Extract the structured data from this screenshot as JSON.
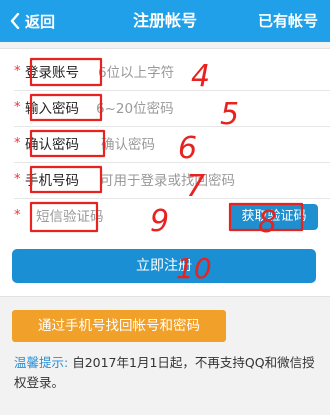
{
  "header": {
    "back_label": "返回",
    "title": "注册帐号",
    "have_account": "已有帐号"
  },
  "form": {
    "account": {
      "label": "登录账号",
      "placeholder": "6位以上字符"
    },
    "password": {
      "label": "输入密码",
      "placeholder": "6~20位密码"
    },
    "confirm": {
      "label": "确认密码",
      "placeholder": "确认密码"
    },
    "phone": {
      "label": "手机号码",
      "placeholder": "可用于登录或找回密码"
    },
    "sms": {
      "placeholder": "短信验证码",
      "get_code": "获取验证码"
    },
    "submit": "立即注册"
  },
  "phone_recover": "通过手机号找回帐号和密码",
  "tip": {
    "key": "温馨提示:",
    "text": "自2017年1月1日起，不再支持QQ和微信授权登录。"
  },
  "annotations": {
    "numbers": [
      "4",
      "5",
      "6",
      "7",
      "8",
      "9",
      "10"
    ],
    "color": "#e8231f"
  },
  "colors": {
    "topbar": "#1fa0e8",
    "submit": "#1a8fd3",
    "phone_button": "#f1a02a"
  }
}
